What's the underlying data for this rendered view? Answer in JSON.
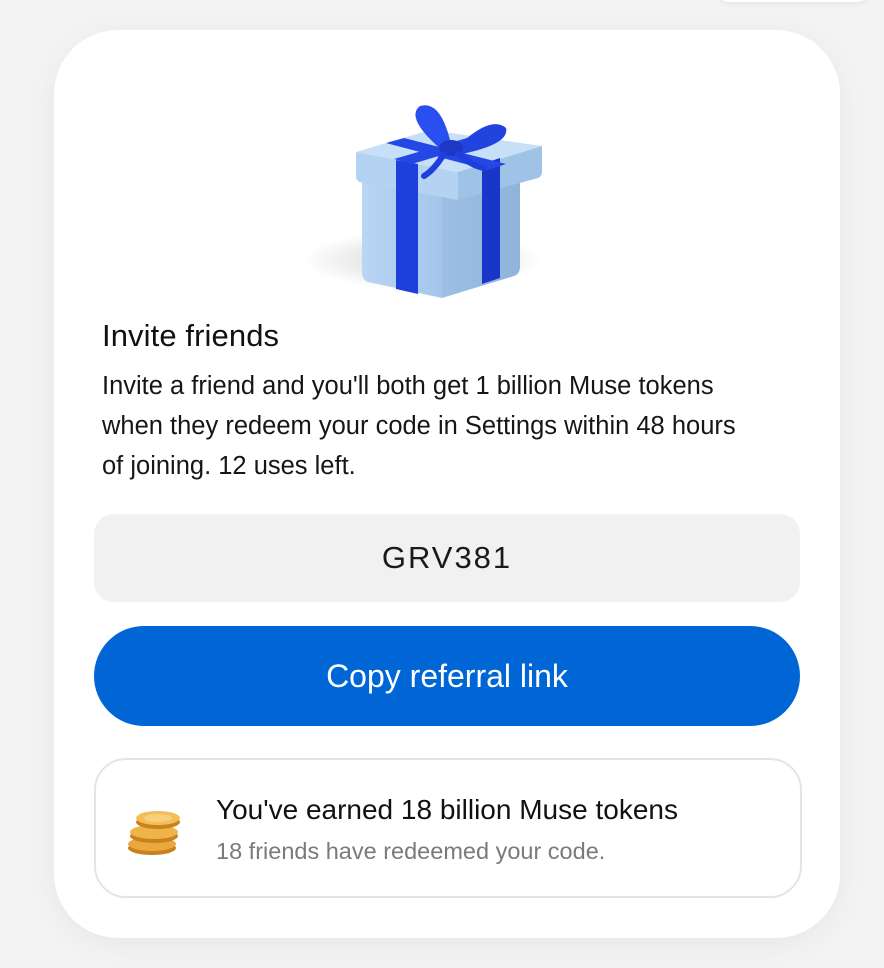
{
  "invite": {
    "title": "Invite friends",
    "description": "Invite a friend and you'll both get 1 billion Muse tokens when they redeem your code in Settings within 48 hours of joining. 12 uses left.",
    "code": "GRV381",
    "copy_button_label": "Copy referral link"
  },
  "earned": {
    "title": "You've earned 18 billion Muse tokens",
    "subtitle": "18 friends have redeemed your code."
  },
  "colors": {
    "accent": "#0066d6",
    "gift_box": "#a9cdf0",
    "ribbon": "#1f3fdc",
    "coin": "#e7a53a"
  },
  "icons": {
    "gift": "gift-box-icon",
    "coins": "coin-stack-icon"
  }
}
